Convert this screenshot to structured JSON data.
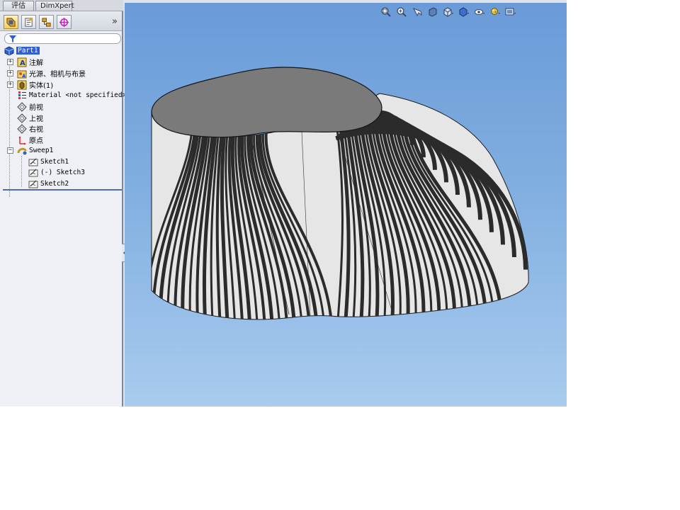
{
  "tabs": [
    {
      "label": "评估"
    },
    {
      "label": "DimXpert"
    }
  ],
  "panel": {
    "toolbar_icons": [
      "feature-manager-icon",
      "property-manager-icon",
      "configuration-manager-icon",
      "dimxpert-manager-icon"
    ],
    "more_glyph": "»"
  },
  "tree": {
    "root": {
      "label": "Part1",
      "icon": "part-icon"
    },
    "items": [
      {
        "label": "注解",
        "icon": "annotations-icon",
        "expander": "+"
      },
      {
        "label": "光源、相机与布景",
        "icon": "lights-cameras-icon",
        "expander": "+"
      },
      {
        "label": "实体(1)",
        "icon": "solid-bodies-icon",
        "expander": "+"
      },
      {
        "label": "Material <not specified>",
        "icon": "material-icon"
      },
      {
        "label": "前视",
        "icon": "plane-icon"
      },
      {
        "label": "上视",
        "icon": "plane-icon"
      },
      {
        "label": "右视",
        "icon": "plane-icon"
      },
      {
        "label": "原点",
        "icon": "origin-icon"
      },
      {
        "label": "Sweep1",
        "icon": "sweep-icon",
        "expander": "−"
      }
    ],
    "children": [
      {
        "label": "Sketch1",
        "icon": "sketch-icon"
      },
      {
        "label": "(-) Sketch3",
        "icon": "sketch-icon"
      },
      {
        "label": "Sketch2",
        "icon": "sketch-icon"
      }
    ]
  },
  "view_toolbar": [
    "zoom-to-fit-icon",
    "zoom-area-icon",
    "previous-view-icon",
    "section-view-icon",
    "view-orientation-icon",
    "display-style-icon",
    "hide-show-icon",
    "edit-appearance-icon",
    "apply-scene-icon"
  ],
  "colors": {
    "selection": "#2f5fd0",
    "viewport_top": "#6a9bd8",
    "viewport_bottom": "#a9cbee",
    "model_top_face": "#7a7a7a",
    "stripe_dark": "#2b2b2b",
    "stripe_light": "#e6e6e6"
  }
}
